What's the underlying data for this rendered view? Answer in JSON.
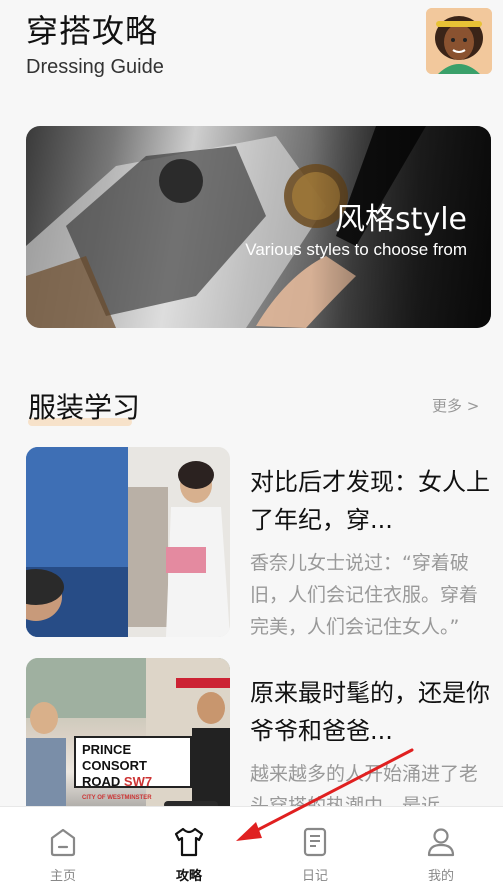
{
  "header": {
    "title": "穿搭攻略",
    "subtitle": "Dressing Guide"
  },
  "banner": {
    "title": "风格style",
    "subtitle": "Various styles to choose from"
  },
  "section": {
    "title": "服装学习",
    "more": "更多 >"
  },
  "articles": [
    {
      "title": "对比后才发现：女人上了年纪，穿...",
      "desc": "香奈儿女士说过：“穿着破旧，人们会记住衣服。穿着完美，人们会记住女人。”"
    },
    {
      "title": "原来最时髦的，还是你爷爷和爸爸...",
      "desc": "越来越多的人开始涌进了老头穿搭的热潮中，最近"
    }
  ],
  "sign": {
    "line1": "PRINCE CONSORT",
    "line2": "ROAD",
    "code": "SW7",
    "city": "CITY OF WESTMINSTER"
  },
  "tabbar": [
    {
      "label": "主页",
      "icon": "home-icon",
      "active": false
    },
    {
      "label": "攻略",
      "icon": "shirt-icon",
      "active": true
    },
    {
      "label": "日记",
      "icon": "notebook-icon",
      "active": false
    },
    {
      "label": "我的",
      "icon": "user-icon",
      "active": false
    }
  ],
  "colors": {
    "background": "#f7f7f7",
    "accent_underline": "#f7d9b6",
    "muted_text": "#999999",
    "annotation_arrow": "#e02020"
  }
}
